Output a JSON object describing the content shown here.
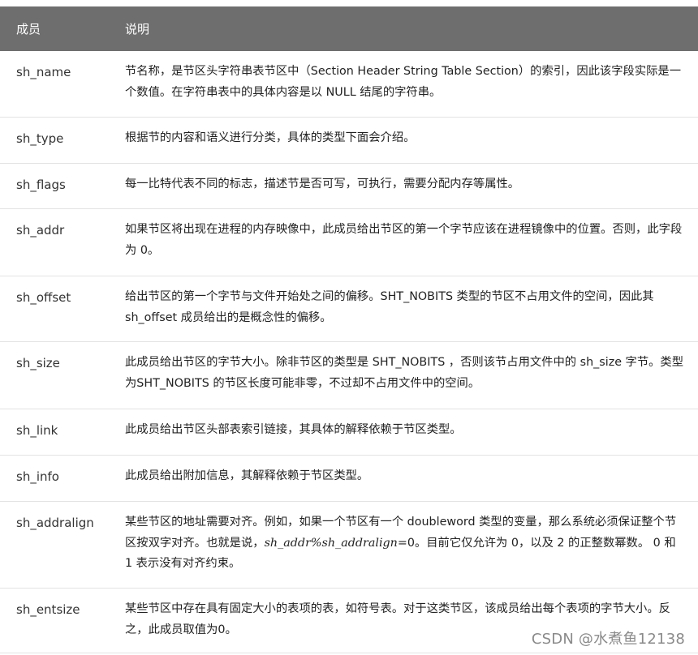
{
  "header": {
    "member": "成员",
    "description": "说明"
  },
  "rows": [
    {
      "member": "sh_name",
      "description": "节名称，是节区头字符串表节区中（Section Header String Table Section）的索引，因此该字段实际是一个数值。在字符串表中的具体内容是以 NULL 结尾的字符串。"
    },
    {
      "member": "sh_type",
      "description": "根据节的内容和语义进行分类，具体的类型下面会介绍。"
    },
    {
      "member": "sh_flags",
      "description": "每一比特代表不同的标志，描述节是否可写，可执行，需要分配内存等属性。"
    },
    {
      "member": "sh_addr",
      "description": "如果节区将出现在进程的内存映像中，此成员给出节区的第一个字节应该在进程镜像中的位置。否则，此字段为 0。"
    },
    {
      "member": "sh_offset",
      "description": "给出节区的第一个字节与文件开始处之间的偏移。SHT_NOBITS 类型的节区不占用文件的空间，因此其 sh_offset 成员给出的是概念性的偏移。"
    },
    {
      "member": "sh_size",
      "description": "此成员给出节区的字节大小。除非节区的类型是 SHT_NOBITS ，否则该节占用文件中的 sh_size 字节。类型为SHT_NOBITS 的节区长度可能非零，不过却不占用文件中的空间。"
    },
    {
      "member": "sh_link",
      "description": "此成员给出节区头部表索引链接，其具体的解释依赖于节区类型。"
    },
    {
      "member": "sh_info",
      "description": "此成员给出附加信息，其解释依赖于节区类型。"
    },
    {
      "member": "sh_addralign",
      "description_before": "某些节区的地址需要对齐。例如，如果一个节区有一个 doubleword 类型的变量，那么系统必须保证整个节区按双字对齐。也就是说，",
      "description_math": "sh_addr%sh_addralign",
      "description_after": "=0。目前它仅允许为 0，以及 2 的正整数幂数。 0 和 1 表示没有对齐约束。"
    },
    {
      "member": "sh_entsize",
      "description": "某些节区中存在具有固定大小的表项的表，如符号表。对于这类节区，该成员给出每个表项的字节大小。反之，此成员取值为0。"
    }
  ],
  "watermark": "CSDN @水煮鱼12138"
}
